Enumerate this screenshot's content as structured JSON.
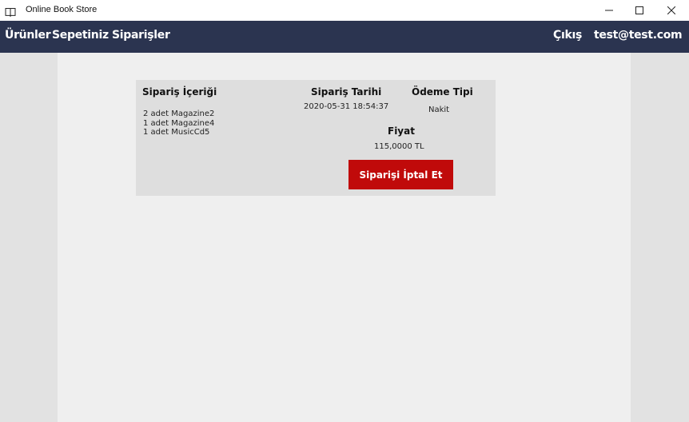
{
  "window": {
    "title": "Online Book Store",
    "icon": "open-book-icon"
  },
  "nav": {
    "products": "Ürünler",
    "cart": "Sepetiniz",
    "orders": "Siparişler",
    "logout": "Çıkış",
    "user_email": "test@test.com"
  },
  "order": {
    "contents_header": "Sipariş İçeriği",
    "items": [
      "2 adet Magazine2",
      "1 adet Magazine4",
      "1 adet MusicCd5"
    ],
    "date_header": "Sipariş Tarihi",
    "date_value": "2020-05-31 18:54:37",
    "payment_header": "Ödeme Tipi",
    "payment_value": "Nakit",
    "price_header": "Fiyat",
    "price_value": "115,0000 TL",
    "cancel_label": "Siparişi İptal Et"
  },
  "colors": {
    "navbar": "#2b3450",
    "cancel_button": "#c00a0a",
    "card": "#dedede",
    "page": "#efefef",
    "sides": "#e2e2e2"
  }
}
